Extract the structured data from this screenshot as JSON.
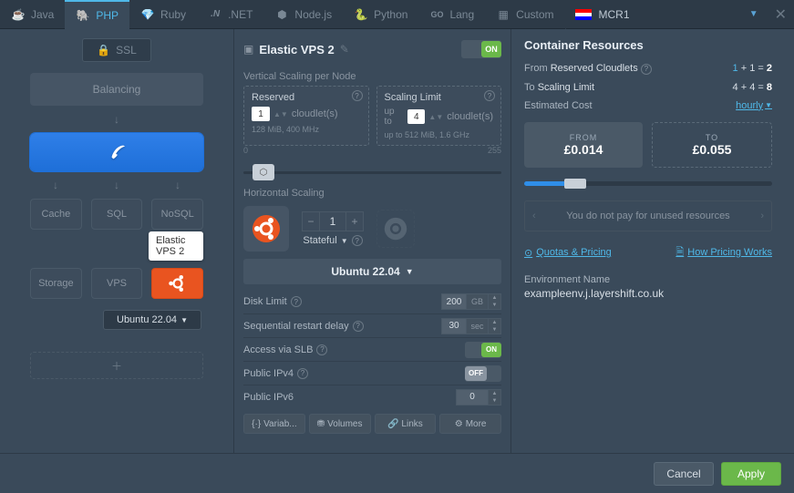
{
  "tabs": {
    "java": "Java",
    "php": "PHP",
    "ruby": "Ruby",
    "dotnet": ".NET",
    "nodejs": "Node.js",
    "python": "Python",
    "lang": "Lang",
    "custom": "Custom"
  },
  "region": {
    "name": "MCR1"
  },
  "left": {
    "ssl": "SSL",
    "balancing": "Balancing",
    "cache": "Cache",
    "sql": "SQL",
    "nosql": "NoSQL",
    "storage": "Storage",
    "vps": "VPS",
    "ubuntu": "Ubuntu 22.04",
    "tooltip": "Elastic VPS 2"
  },
  "mid": {
    "title": "Elastic VPS 2",
    "on": "ON",
    "off": "OFF",
    "vertical_title": "Vertical Scaling per Node",
    "reserved_label": "Reserved",
    "reserved_val": "1",
    "reserved_unit": "cloudlet(s)",
    "reserved_sub": "128 MiB, 400 MHz",
    "limit_label": "Scaling Limit",
    "limit_prefix": "up to",
    "limit_val": "4",
    "limit_unit": "cloudlet(s)",
    "limit_sub": "up to 512 MiB, 1.6 GHz",
    "slider_min": "0",
    "slider_max": "255",
    "horiz_title": "Horizontal Scaling",
    "horiz_count": "1",
    "stateful": "Stateful",
    "node_sel": "Ubuntu 22.04",
    "disk_limit": "Disk Limit",
    "disk_val": "200",
    "disk_unit": "GB",
    "restart_delay": "Sequential restart delay",
    "restart_val": "30",
    "restart_unit": "sec",
    "slb": "Access via SLB",
    "ipv4": "Public IPv4",
    "ipv6": "Public IPv6",
    "ipv6_val": "0",
    "btn_variables": "Variab...",
    "btn_volumes": "Volumes",
    "btn_links": "Links",
    "btn_more": "More"
  },
  "right": {
    "title": "Container Resources",
    "from_label": "From",
    "from_name": "Reserved Cloudlets",
    "from_expr_a": "1",
    "from_expr_b": "1",
    "from_expr_total": "2",
    "to_label": "To",
    "to_name": "Scaling Limit",
    "to_expr_a": "4",
    "to_expr_b": "4",
    "to_expr_total": "8",
    "cost_label": "Estimated Cost",
    "cost_period": "hourly",
    "price_from_label": "FROM",
    "price_from": "£0.014",
    "price_to_label": "TO",
    "price_to": "£0.055",
    "unused_msg": "You do not pay for unused resources",
    "quotas": "Quotas & Pricing",
    "how_pricing": "How Pricing Works",
    "env_label": "Environment Name",
    "env_name": "exampleenv.j.layershift.co.uk"
  },
  "footer": {
    "cancel": "Cancel",
    "apply": "Apply"
  }
}
